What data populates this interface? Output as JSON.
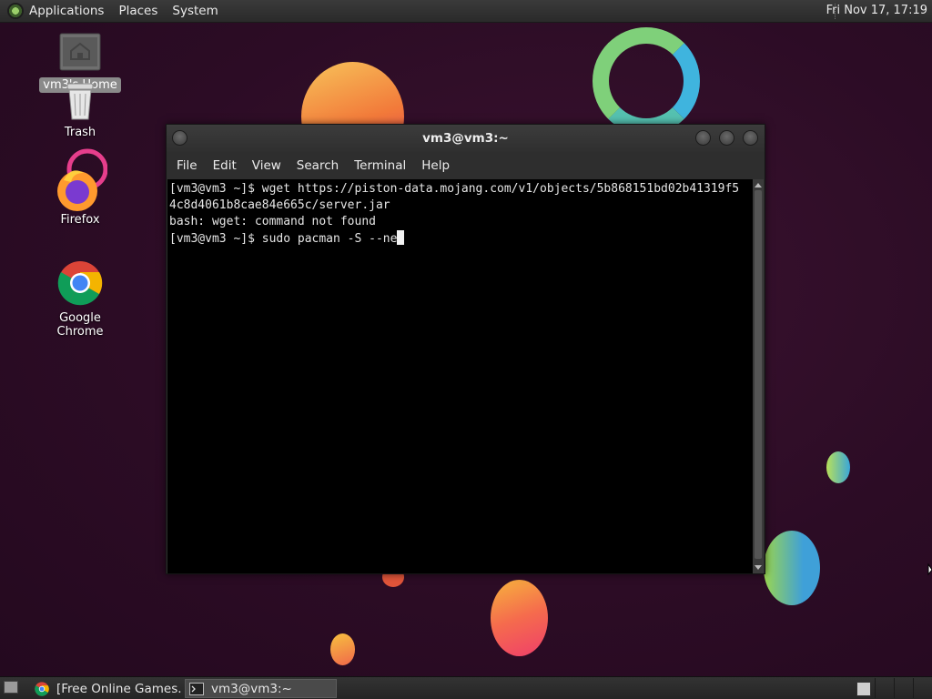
{
  "top_panel": {
    "menus": [
      "Applications",
      "Places",
      "System"
    ],
    "clock": "Fri Nov 17, 17:19"
  },
  "desktop_icons": [
    {
      "label": "vm3's Home",
      "icon": "home-folder-icon"
    },
    {
      "label": "Trash",
      "icon": "trash-icon"
    },
    {
      "label": "Firefox",
      "icon": "firefox-icon"
    },
    {
      "label": "Google Chrome",
      "icon": "chrome-icon"
    }
  ],
  "terminal": {
    "title": "vm3@vm3:~",
    "menu": [
      "File",
      "Edit",
      "View",
      "Search",
      "Terminal",
      "Help"
    ],
    "lines": [
      "[vm3@vm3 ~]$ wget https://piston-data.mojang.com/v1/objects/5b868151bd02b41319f5",
      "4c8d4061b8cae84e665c/server.jar",
      "bash: wget: command not found",
      "[vm3@vm3 ~]$ sudo pacman -S --ne"
    ]
  },
  "taskbar": {
    "tasks": [
      {
        "label": "[Free Online Games...",
        "icon": "chrome-icon",
        "active": false
      },
      {
        "label": "vm3@vm3:~",
        "icon": "terminal-icon",
        "active": true
      }
    ]
  }
}
